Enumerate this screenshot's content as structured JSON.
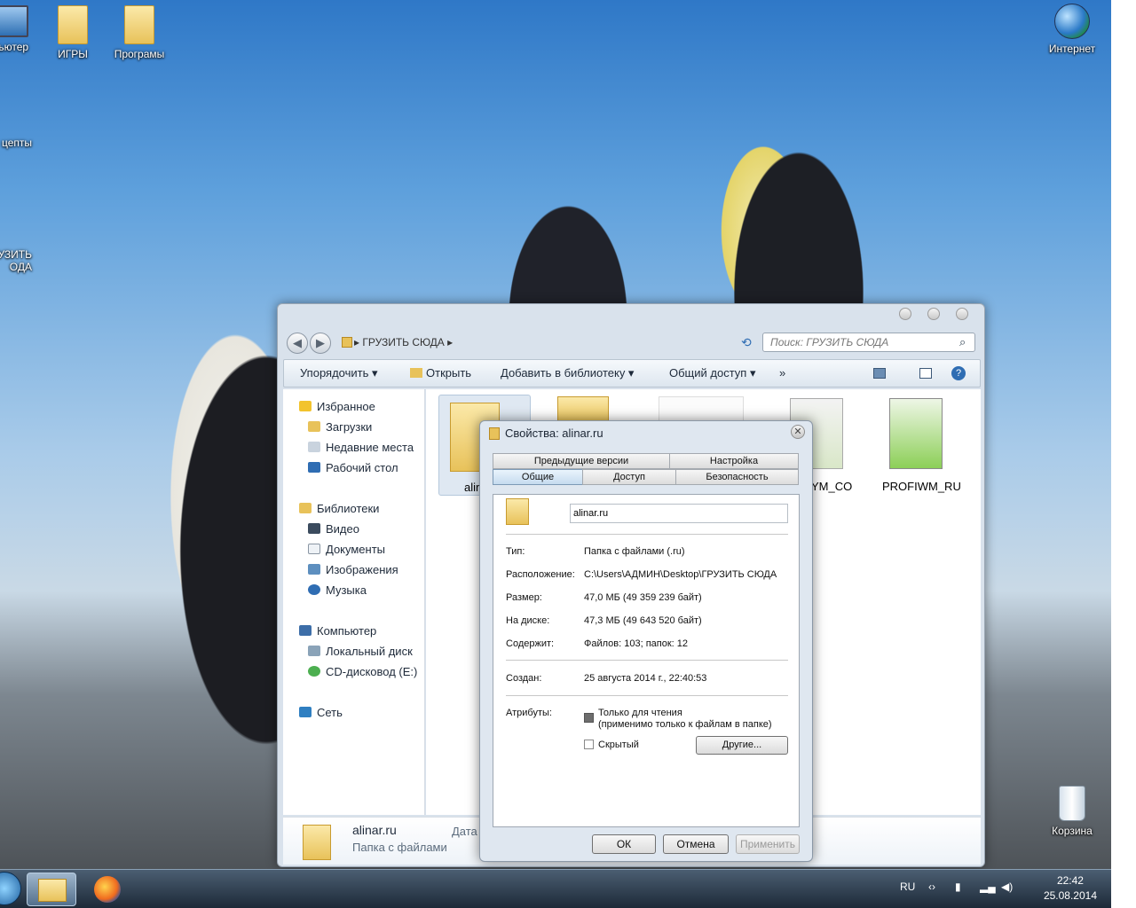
{
  "desktop": {
    "icons": [
      {
        "label": "пьютер",
        "icon": "computer-icon"
      },
      {
        "label": "ИГРЫ",
        "icon": "folder-icon"
      },
      {
        "label": "Програмы",
        "icon": "folder-icon"
      },
      {
        "label": "цепты",
        "icon": "folder-icon"
      },
      {
        "label": "УЗИТЬ\nОДА",
        "icon": "folder-icon"
      },
      {
        "label": "Интернет",
        "icon": "globe-icon"
      },
      {
        "label": "Корзина",
        "icon": "recycle-bin-icon"
      }
    ]
  },
  "explorer": {
    "breadcrumb": "▸ ГРУЗИТЬ СЮДА ▸",
    "search_placeholder": "Поиск: ГРУЗИТЬ СЮДА",
    "toolbar": {
      "organize": "Упорядочить ▾",
      "open": "Открыть",
      "add_to_library": "Добавить в библиотеку ▾",
      "share": "Общий доступ ▾",
      "more": "»"
    },
    "nav": {
      "favorites": "Избранное",
      "downloads": "Загрузки",
      "recent": "Недавние места",
      "desktop": "Рабочий стол",
      "libraries": "Библиотеки",
      "video": "Видео",
      "documents": "Документы",
      "images": "Изображения",
      "music": "Музыка",
      "computer": "Компьютер",
      "local_disk": "Локальный диск",
      "cd_drive": "CD-дисковод (E:)",
      "network": "Сеть"
    },
    "files": [
      {
        "label": "alir"
      },
      {
        "label": "YM_CO"
      },
      {
        "label": "PROFIWM_RU"
      }
    ],
    "details": {
      "name": "alinar.ru",
      "type": "Папка с файлами",
      "date_label": "Дата"
    }
  },
  "dialog": {
    "title": "Свойства: alinar.ru",
    "tabs_top": [
      "Предыдущие версии",
      "Настройка"
    ],
    "tabs_bottom": [
      "Общие",
      "Доступ",
      "Безопасность"
    ],
    "name_value": "alinar.ru",
    "rows": [
      {
        "label": "Тип:",
        "value": "Папка с файлами (.ru)"
      },
      {
        "label": "Расположение:",
        "value": "C:\\Users\\АДМИН\\Desktop\\ГРУЗИТЬ СЮДА"
      },
      {
        "label": "Размер:",
        "value": "47,0 МБ (49 359 239 байт)"
      },
      {
        "label": "На диске:",
        "value": "47,3 МБ (49 643 520 байт)"
      },
      {
        "label": "Содержит:",
        "value": "Файлов: 103; папок: 12"
      },
      {
        "label": "Создан:",
        "value": "25 августа 2014 г., 22:40:53"
      }
    ],
    "attributes_label": "Атрибуты:",
    "readonly_label": "Только для чтения",
    "readonly_note": "(применимо только к файлам в папке)",
    "hidden_label": "Скрытый",
    "other_button": "Другие...",
    "ok": "ОК",
    "cancel": "Отмена",
    "apply": "Применить"
  },
  "taskbar": {
    "lang": "RU",
    "time": "22:42",
    "date": "25.08.2014"
  }
}
